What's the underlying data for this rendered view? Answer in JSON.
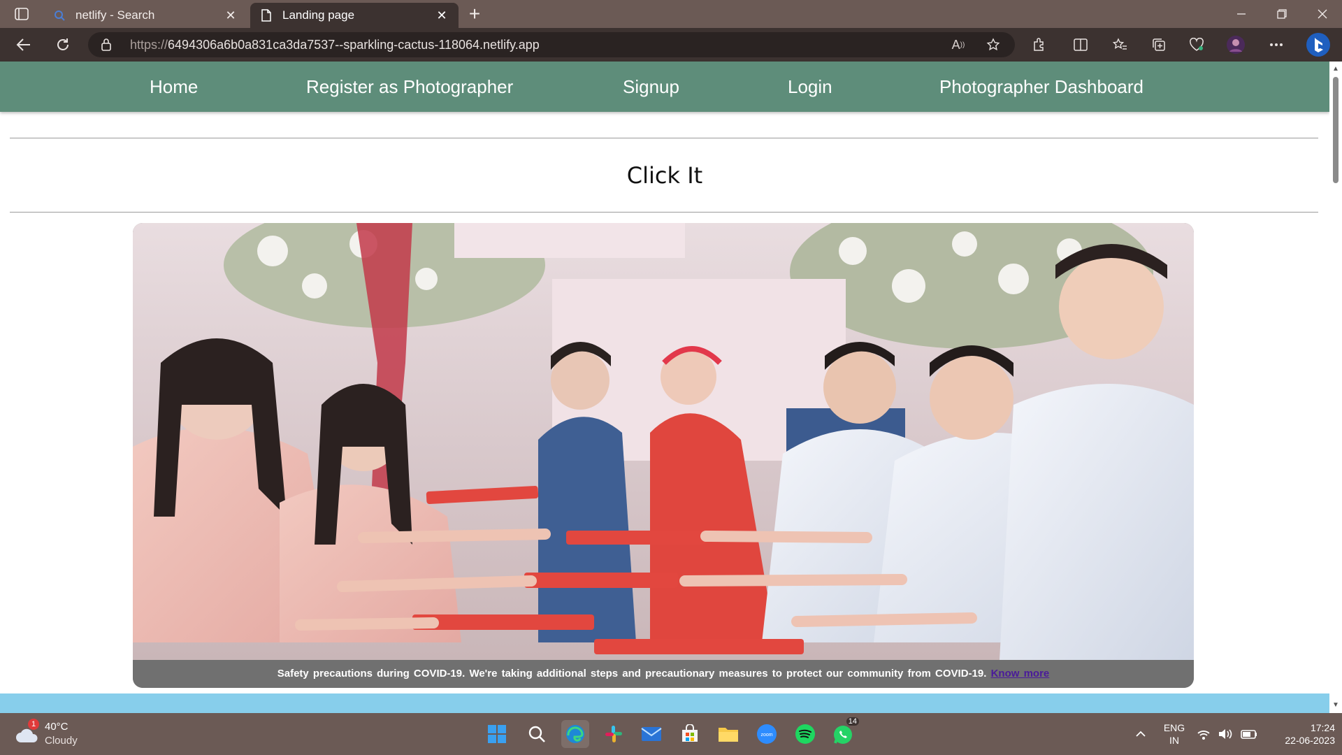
{
  "browser": {
    "tabs": [
      {
        "title": "netlify - Search",
        "icon": "bing-search-icon",
        "active": false
      },
      {
        "title": "Landing page",
        "icon": "page-icon",
        "active": true
      }
    ],
    "new_tab_icon": "plus-icon",
    "url_scheme": "https://",
    "url_rest": "6494306a6b0a831ca3da7537--sparkling-cactus-118064.netlify.app"
  },
  "page": {
    "nav": [
      "Home",
      "Register as Photographer",
      "Signup",
      "Login",
      "Photographer Dashboard"
    ],
    "brand": "Click It",
    "covid_notice": "Safety precautions during COVID-19. We're taking additional steps and precautionary measures to protect our community from COVID-19.",
    "covid_link": "Know more"
  },
  "colors": {
    "navbar": "#5e8d7a",
    "tab_strip": "#6b5a55",
    "toolbar": "#3c3230",
    "footer_band": "#87ceeb",
    "notice_bar": "#707070"
  },
  "taskbar": {
    "weather": {
      "temp": "40°C",
      "condition": "Cloudy",
      "badge": "1"
    },
    "apps": [
      "start",
      "search",
      "edge",
      "slack",
      "mail",
      "store",
      "file-explorer",
      "zoom",
      "spotify",
      "whatsapp"
    ],
    "whatsapp_badge": "14",
    "lang": "ENG",
    "region": "IN",
    "time": "17:24",
    "date": "22-06-2023"
  }
}
